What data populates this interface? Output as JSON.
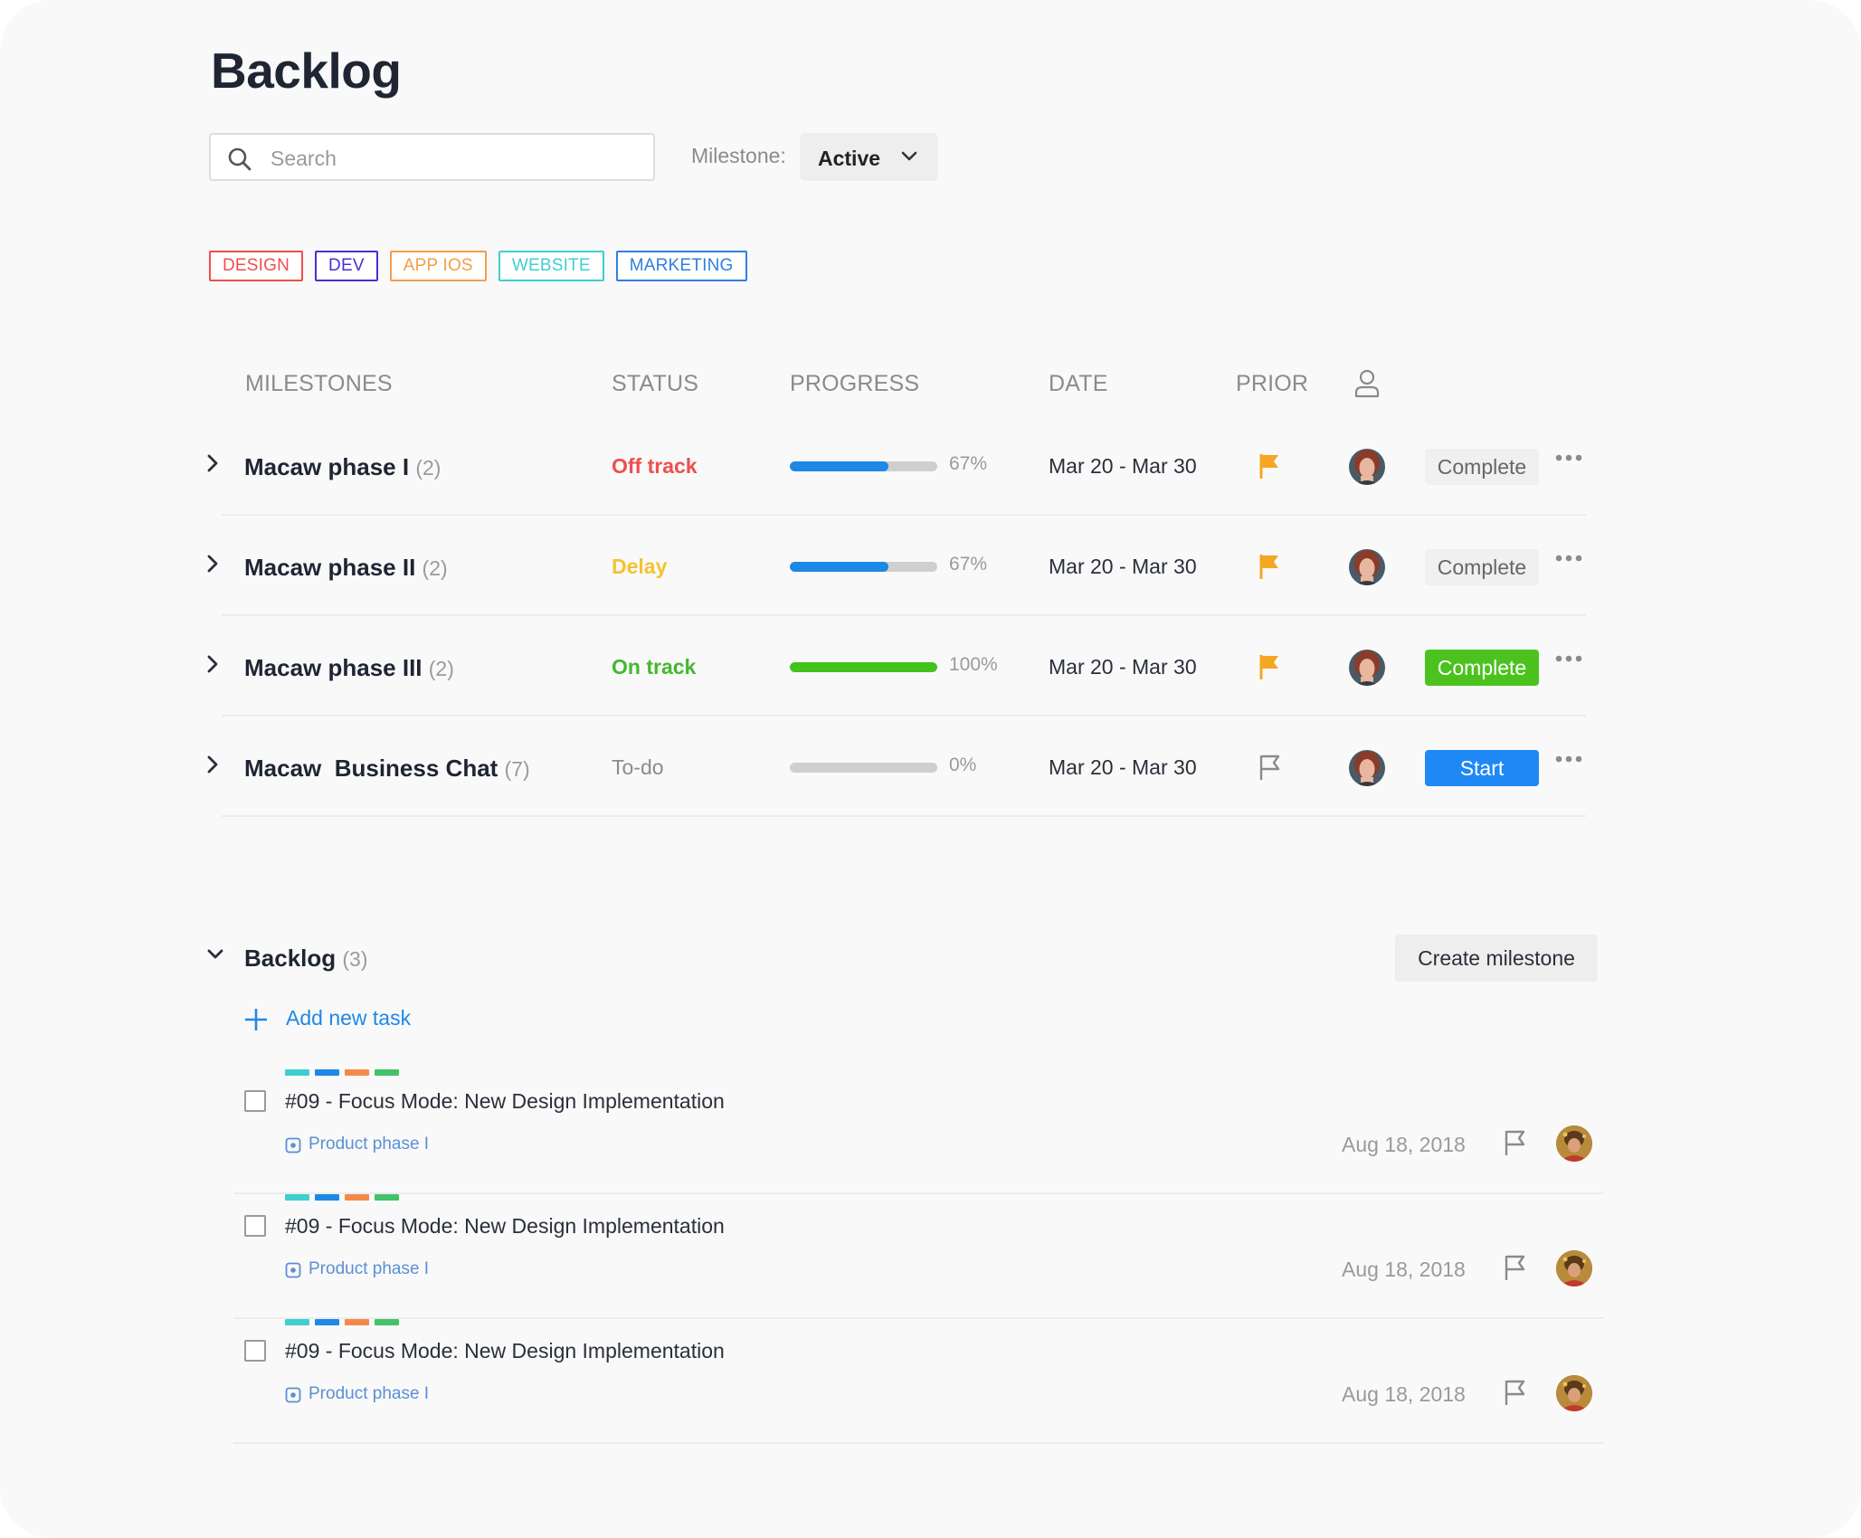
{
  "page": {
    "title": "Backlog"
  },
  "search": {
    "placeholder": "Search"
  },
  "milestone_filter": {
    "label": "Milestone:",
    "value": "Active"
  },
  "tags": [
    {
      "label": "DESIGN",
      "color": "#f04e4e"
    },
    {
      "label": "DEV",
      "color": "#4a2fd4"
    },
    {
      "label": "APP IOS",
      "color": "#f59d4a"
    },
    {
      "label": "WEBSITE",
      "color": "#3fcfcf"
    },
    {
      "label": "MARKETING",
      "color": "#2f7fe0"
    }
  ],
  "table": {
    "headers": {
      "milestones": "MILESTONES",
      "status": "STATUS",
      "progress": "PROGRESS",
      "date": "DATE",
      "prior": "PRIOR",
      "assignee_icon": "person-icon"
    },
    "rows": [
      {
        "name": "Macaw phase I",
        "count": "(2)",
        "status": "Off track",
        "status_color": "#f04e4e",
        "progress": 0.67,
        "progress_label": "67%",
        "progress_color": "#1e88e5",
        "date": "Mar 20 - Mar 30",
        "flagged": true,
        "action": "Complete",
        "action_style": "neutral"
      },
      {
        "name": "Macaw phase II",
        "count": "(2)",
        "status": "Delay",
        "status_color": "#f5c230",
        "progress": 0.67,
        "progress_label": "67%",
        "progress_color": "#1e88e5",
        "date": "Mar 20 - Mar 30",
        "flagged": true,
        "action": "Complete",
        "action_style": "neutral"
      },
      {
        "name": "Macaw phase III",
        "count": "(2)",
        "status": "On track",
        "status_color": "#43b82e",
        "progress": 1.0,
        "progress_label": "100%",
        "progress_color": "#43c21a",
        "date": "Mar 20 - Mar 30",
        "flagged": true,
        "action": "Complete",
        "action_style": "green"
      },
      {
        "name": "Macaw  Business Chat",
        "count": "(7)",
        "status": "To-do",
        "status_color": "#8b8b8b",
        "progress": 0.0,
        "progress_label": "0%",
        "progress_color": "#1e88e5",
        "date": "Mar 20 - Mar 30",
        "flagged": false,
        "action": "Start",
        "action_style": "blue"
      }
    ]
  },
  "backlog": {
    "title": "Backlog",
    "count": "(3)",
    "create_button": "Create milestone",
    "add_task": "Add new task",
    "tasks": [
      {
        "title": "#09 - Focus Mode: New Design Implementation",
        "phase": "Product phase I",
        "date": "Aug 18, 2018"
      },
      {
        "title": "#09 - Focus Mode: New Design Implementation",
        "phase": "Product phase I",
        "date": "Aug 18, 2018"
      },
      {
        "title": "#09 - Focus Mode: New Design Implementation",
        "phase": "Product phase I",
        "date": "Aug 18, 2018"
      }
    ],
    "stripe_colors": [
      "#3fcfcf",
      "#1e88e5",
      "#f5894a",
      "#43c26a"
    ]
  },
  "colors": {
    "flag_active": "#f5a623",
    "flag_inactive": "#8b8b8b",
    "link": "#1e88e5"
  }
}
